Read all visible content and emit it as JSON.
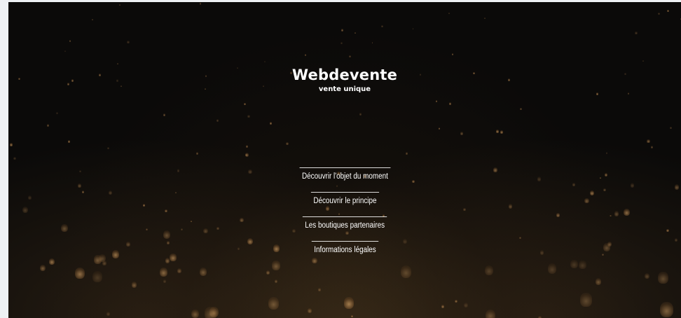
{
  "site": {
    "title": "Webdevente",
    "subtitle": "vente unique"
  },
  "nav": {
    "items": [
      {
        "label": "Découvrir l'objet du moment"
      },
      {
        "label": "Découvrir le principe"
      },
      {
        "label": "Les boutiques partenaires"
      },
      {
        "label": "Informations légales"
      }
    ]
  },
  "colors": {
    "background": "#0b0a09",
    "text": "#ffffff",
    "page_margin": "#eef1f4",
    "lantern_glow": "#d2a064"
  }
}
